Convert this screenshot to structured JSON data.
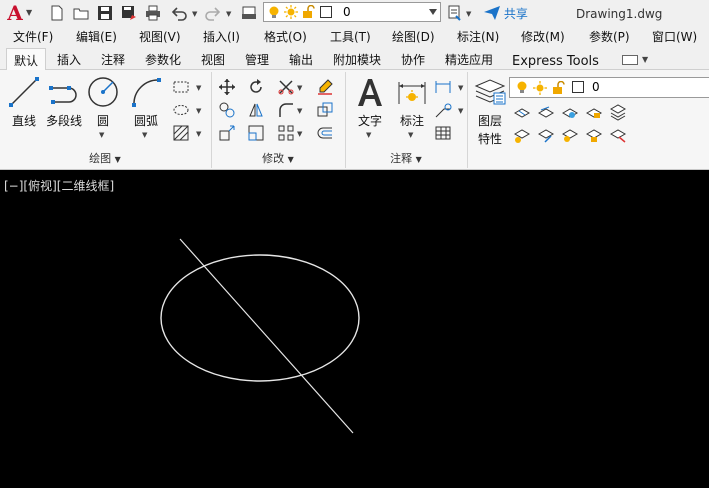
{
  "app": {
    "logo_letter": "A",
    "document_title": "Drawing1.dwg",
    "share_label": "共享"
  },
  "quick_access": {
    "layer": {
      "name": "0"
    }
  },
  "menu": [
    "文件(F)",
    "编辑(E)",
    "视图(V)",
    "插入(I)",
    "格式(O)",
    "工具(T)",
    "绘图(D)",
    "标注(N)",
    "修改(M)",
    "参数(P)",
    "窗口(W)"
  ],
  "tabs": [
    "默认",
    "插入",
    "注释",
    "参数化",
    "视图",
    "管理",
    "输出",
    "附加模块",
    "协作",
    "精选应用",
    "Express Tools"
  ],
  "active_tab_index": 0,
  "ribbon": {
    "draw": {
      "title": "绘图",
      "line": "直线",
      "polyline": "多段线",
      "circle": "圆",
      "arc": "圆弧"
    },
    "modify": {
      "title": "修改"
    },
    "annotation": {
      "title": "注释",
      "text": "文字",
      "dimension": "标注"
    },
    "layers": {
      "properties_line1": "图层",
      "properties_line2": "特性",
      "current_layer": "0"
    }
  },
  "viewport": {
    "label": "[−][俯视][二维线框]"
  },
  "colors": {
    "canvas_bg": "#000000",
    "geometry": "#e6e6e6",
    "accent": "#1a73c9",
    "brand": "#c8102e"
  }
}
